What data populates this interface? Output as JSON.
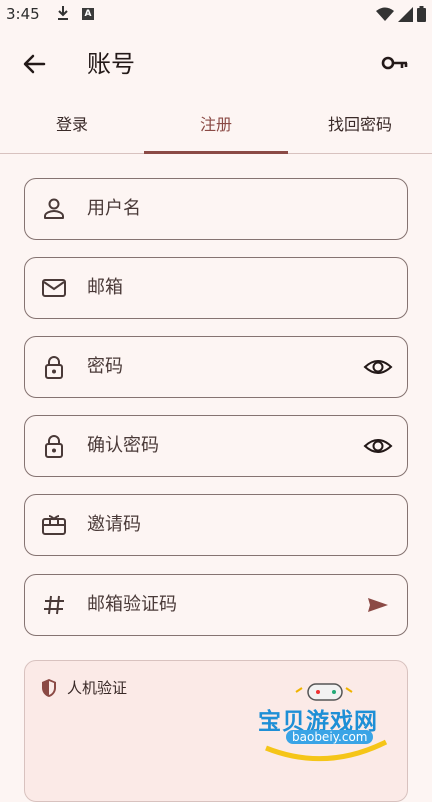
{
  "status": {
    "time": "3:45",
    "a_badge": "A"
  },
  "header": {
    "title": "账号"
  },
  "tabs": [
    {
      "label": "登录"
    },
    {
      "label": "注册"
    },
    {
      "label": "找回密码"
    }
  ],
  "form": {
    "username": {
      "placeholder": "用户名",
      "icon": "person-icon"
    },
    "email": {
      "placeholder": "邮箱",
      "icon": "mail-icon"
    },
    "password": {
      "placeholder": "密码",
      "icon": "lock-icon"
    },
    "confirm_password": {
      "placeholder": "确认密码",
      "icon": "lock-icon"
    },
    "invite_code": {
      "placeholder": "邀请码",
      "icon": "gift-card-icon"
    },
    "email_code": {
      "placeholder": "邮箱验证码",
      "icon": "hash-icon"
    }
  },
  "captcha": {
    "label": "人机验证"
  },
  "watermark": {
    "brand": "宝贝游戏网",
    "url": "baobeiy.com"
  },
  "colors": {
    "accent": "#8B4A45",
    "background": "#FDF5F3",
    "outline": "#857371"
  }
}
